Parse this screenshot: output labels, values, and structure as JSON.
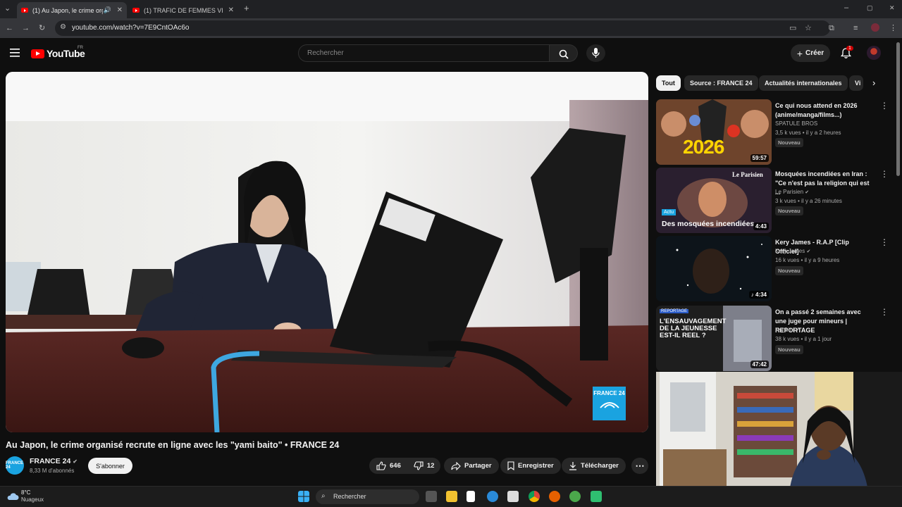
{
  "browser": {
    "tabs": [
      {
        "title": "(1) Au Japon, le crime organi",
        "active": true
      },
      {
        "title": "(1) TRAFIC DE FEMMES VIETNA",
        "active": false
      }
    ],
    "url": "youtube.com/watch?v=7E9CntOAc6o"
  },
  "youtube": {
    "logo_text": "YouTube",
    "region": "FR",
    "search_placeholder": "Rechercher",
    "create_label": "Créer",
    "notification_count": "1"
  },
  "video": {
    "title": "Au Japon, le crime organisé recrute en ligne avec les \"yami baito\" • FRANCE 24",
    "watermark": "FRANCE 24",
    "channel": {
      "name": "FRANCE 24",
      "subscribers": "8,33 M d'abonnés",
      "avatar_text": "FRANCE 24"
    },
    "subscribe_label": "S'abonner",
    "likes": "646",
    "dislikes": "12",
    "share_label": "Partager",
    "save_label": "Enregistrer",
    "download_label": "Télécharger"
  },
  "chips": [
    "Tout",
    "Source : FRANCE 24",
    "Actualités internationales",
    "Vi"
  ],
  "recommendations": [
    {
      "title": "Ce qui nous attend en 2026 (anime/manga/films...)",
      "channel": "SPATULE BROS",
      "verified": false,
      "meta": "3,5 k vues • il y a 2 heures",
      "badge": "Nouveau",
      "duration": "59:57",
      "thumb_text": "2026"
    },
    {
      "title": "Mosquées incendiées en Iran : \"Ce n'est pas la religion qui est ...",
      "channel": "Le Parisien",
      "verified": true,
      "meta": "3 k vues • il y a 26 minutes",
      "badge": "Nouveau",
      "duration": "4:43",
      "thumb_text": "Des mosquées incendiées",
      "thumb_tag": "Actu",
      "thumb_brand": "Le Parisien"
    },
    {
      "title": "Kery James - R.A.P [Clip Officiel]",
      "channel": "Kery James",
      "verified": true,
      "meta": "16 k vues • il y a 9 heures",
      "badge": "Nouveau",
      "duration": "4:34"
    },
    {
      "title": "On a passé 2 semaines avec une juge pour mineurs | REPORTAGE",
      "channel": "Konbini",
      "verified": true,
      "meta": "38 k vues • il y a 1 jour",
      "badge": "Nouveau",
      "duration": "47:42",
      "thumb_tag": "REPORTAGE",
      "thumb_text": "L'ENSAUVAGEMENT DE LA JEUNESSE EST-IL REEL ?"
    }
  ],
  "taskbar": {
    "temperature": "8°C",
    "condition": "Nuageux",
    "search_label": "Rechercher"
  },
  "colors": {
    "yt_red": "#ff0000",
    "background": "#0f0f0f",
    "france24_blue": "#1aa3e0"
  }
}
